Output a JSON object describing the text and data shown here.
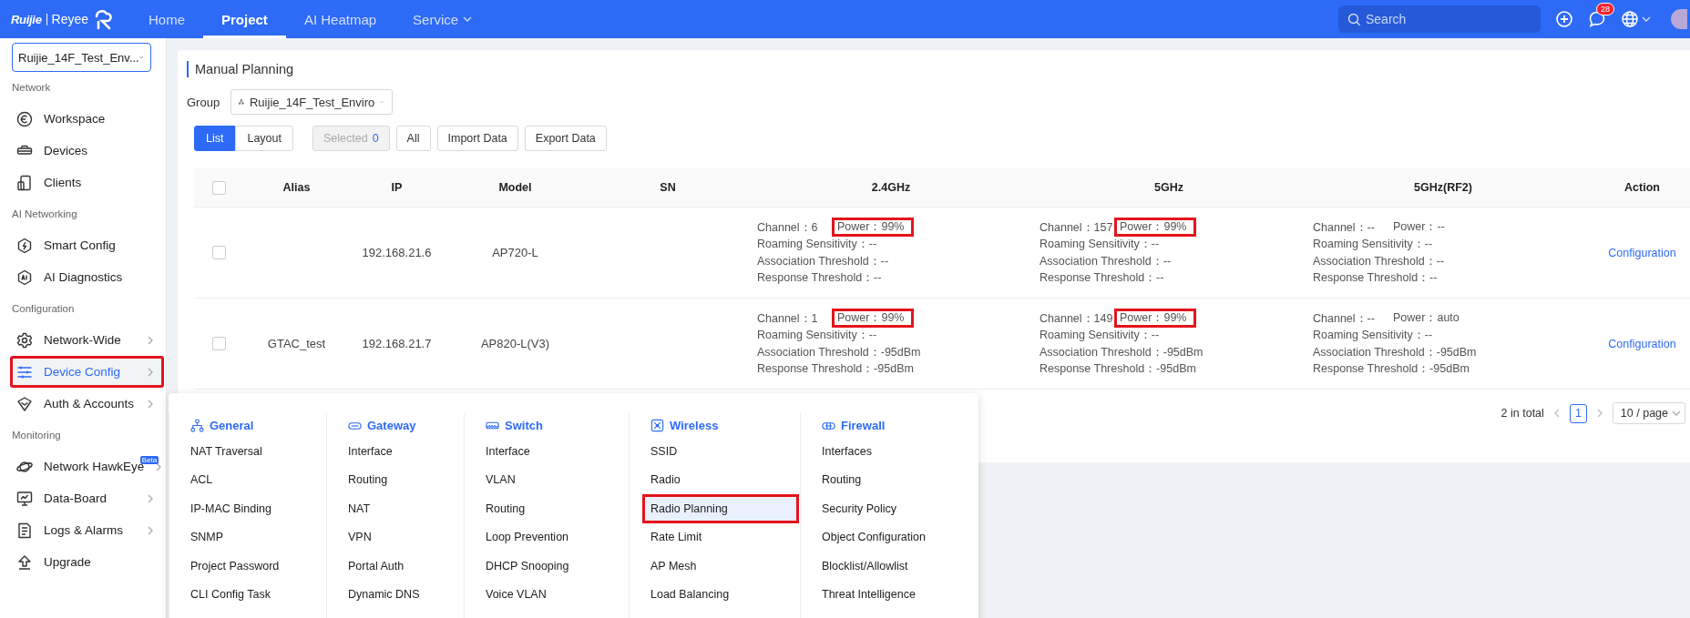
{
  "topbar": {
    "logo": {
      "brand": "Ruijie",
      "product": "Reyee"
    },
    "nav": [
      {
        "label": "Home",
        "selected": false,
        "has_dropdown": false
      },
      {
        "label": "Project",
        "selected": true,
        "has_dropdown": false
      },
      {
        "label": "AI Heatmap",
        "selected": false,
        "has_dropdown": false
      },
      {
        "label": "Service",
        "selected": false,
        "has_dropdown": true
      }
    ],
    "search": {
      "placeholder": "Search"
    },
    "notifications": {
      "badge": "28"
    }
  },
  "sidebar": {
    "project_select": {
      "value": "Ruijie_14F_Test_Env..."
    },
    "sections": [
      {
        "title": "Network",
        "items": [
          {
            "label": "Workspace",
            "selected": false,
            "highlighted": false,
            "has_submenu": false
          },
          {
            "label": "Devices",
            "selected": false,
            "highlighted": false,
            "has_submenu": false
          },
          {
            "label": "Clients",
            "selected": false,
            "highlighted": false,
            "has_submenu": false
          }
        ]
      },
      {
        "title": "AI Networking",
        "items": [
          {
            "label": "Smart Config",
            "selected": false,
            "highlighted": false,
            "has_submenu": false
          },
          {
            "label": "AI Diagnostics",
            "selected": false,
            "highlighted": false,
            "has_submenu": false
          }
        ]
      },
      {
        "title": "Configuration",
        "items": [
          {
            "label": "Network-Wide",
            "selected": false,
            "highlighted": false,
            "has_submenu": true
          },
          {
            "label": "Device Config",
            "selected": true,
            "highlighted": true,
            "has_submenu": true
          },
          {
            "label": "Auth & Accounts",
            "selected": false,
            "highlighted": false,
            "has_submenu": true
          }
        ]
      },
      {
        "title": "Monitoring",
        "items": [
          {
            "label": "Network HawkEye",
            "badge": "Beta",
            "selected": false,
            "highlighted": false,
            "has_submenu": true
          },
          {
            "label": "Data-Board",
            "selected": false,
            "highlighted": false,
            "has_submenu": true
          },
          {
            "label": "Logs & Alarms",
            "selected": false,
            "highlighted": false,
            "has_submenu": true
          },
          {
            "label": "Upgrade",
            "selected": false,
            "highlighted": false,
            "has_submenu": false
          }
        ]
      }
    ]
  },
  "planning": {
    "title": "Manual Planning",
    "group": {
      "label": "Group",
      "value": "Ruijie_14F_Test_Enviro"
    },
    "view_toggle": [
      {
        "label": "List",
        "selected": true
      },
      {
        "label": "Layout",
        "selected": false
      }
    ],
    "selected_button": {
      "label": "Selected",
      "count": "0",
      "disabled": true
    },
    "buttons": [
      "All",
      "Import Data",
      "Export Data"
    ],
    "table": {
      "header_checkbox": {
        "checked": false
      },
      "columns": [
        "Alias",
        "IP",
        "Model",
        "SN",
        "2.4GHz",
        "5GHz",
        "5GHz(RF2)",
        "Action"
      ],
      "rows": [
        {
          "checked": false,
          "alias": "",
          "ip": "192.168.21.6",
          "model": "AP720-L",
          "action": "Configuration",
          "radios": [
            {
              "channel": "Channel：6",
              "power": "Power：99%",
              "highlighted": true,
              "details": [
                "Roaming Sensitivity：--",
                "Association Threshold：--",
                "Response Threshold：--"
              ]
            },
            {
              "channel": "Channel：157",
              "power": "Power：99%",
              "highlighted": true,
              "details": [
                "Roaming Sensitivity：--",
                "Association Threshold：--",
                "Response Threshold：--"
              ]
            },
            {
              "channel": "Channel：--",
              "power": "Power：--",
              "highlighted": false,
              "details": [
                "Roaming Sensitivity：--",
                "Association Threshold：--",
                "Response Threshold：--"
              ]
            }
          ]
        },
        {
          "checked": false,
          "alias": "GTAC_test",
          "ip": "192.168.21.7",
          "model": "AP820-L(V3)",
          "action": "Configuration",
          "radios": [
            {
              "channel": "Channel：1",
              "power": "Power：99%",
              "highlighted": true,
              "details": [
                "Roaming Sensitivity：--",
                "Association Threshold：-95dBm",
                "Response Threshold：-95dBm"
              ]
            },
            {
              "channel": "Channel：149",
              "power": "Power：99%",
              "highlighted": true,
              "details": [
                "Roaming Sensitivity：--",
                "Association Threshold：-95dBm",
                "Response Threshold：-95dBm"
              ]
            },
            {
              "channel": "Channel：--",
              "power": "Power：auto",
              "highlighted": false,
              "details": [
                "Roaming Sensitivity：--",
                "Association Threshold：-95dBm",
                "Response Threshold：-95dBm"
              ]
            }
          ]
        }
      ]
    },
    "pagination": {
      "total": "2 in total",
      "pages": [
        {
          "label": "1",
          "selected": true
        }
      ],
      "page_size": "10 / page"
    }
  },
  "config_menu": {
    "columns": [
      {
        "title": "General",
        "items": [
          {
            "label": "NAT Traversal",
            "selected": false,
            "highlighted": false
          },
          {
            "label": "ACL",
            "selected": false,
            "highlighted": false
          },
          {
            "label": "IP-MAC Binding",
            "selected": false,
            "highlighted": false
          },
          {
            "label": "SNMP",
            "selected": false,
            "highlighted": false
          },
          {
            "label": "Project Password",
            "selected": false,
            "highlighted": false
          },
          {
            "label": "CLI Config Task",
            "selected": false,
            "highlighted": false
          }
        ]
      },
      {
        "title": "Gateway",
        "items": [
          {
            "label": "Interface",
            "selected": false,
            "highlighted": false
          },
          {
            "label": "Routing",
            "selected": false,
            "highlighted": false
          },
          {
            "label": "NAT",
            "selected": false,
            "highlighted": false
          },
          {
            "label": "VPN",
            "selected": false,
            "highlighted": false
          },
          {
            "label": "Portal Auth",
            "selected": false,
            "highlighted": false
          },
          {
            "label": "Dynamic DNS",
            "selected": false,
            "highlighted": false
          }
        ]
      },
      {
        "title": "Switch",
        "items": [
          {
            "label": "Interface",
            "selected": false,
            "highlighted": false
          },
          {
            "label": "VLAN",
            "selected": false,
            "highlighted": false
          },
          {
            "label": "Routing",
            "selected": false,
            "highlighted": false
          },
          {
            "label": "Loop Prevention",
            "selected": false,
            "highlighted": false
          },
          {
            "label": "DHCP Snooping",
            "selected": false,
            "highlighted": false
          },
          {
            "label": "Voice VLAN",
            "selected": false,
            "highlighted": false
          }
        ]
      },
      {
        "title": "Wireless",
        "items": [
          {
            "label": "SSID",
            "selected": false,
            "highlighted": false
          },
          {
            "label": "Radio",
            "selected": false,
            "highlighted": false
          },
          {
            "label": "Radio Planning",
            "selected": true,
            "highlighted": true
          },
          {
            "label": "Rate Limit",
            "selected": false,
            "highlighted": false
          },
          {
            "label": "AP Mesh",
            "selected": false,
            "highlighted": false
          },
          {
            "label": "Load Balancing",
            "selected": false,
            "highlighted": false
          }
        ]
      },
      {
        "title": "Firewall",
        "items": [
          {
            "label": "Interfaces",
            "selected": false,
            "highlighted": false
          },
          {
            "label": "Routing",
            "selected": false,
            "highlighted": false
          },
          {
            "label": "Security Policy",
            "selected": false,
            "highlighted": false
          },
          {
            "label": "Object Configuration",
            "selected": false,
            "highlighted": false
          },
          {
            "label": "Blocklist/Allowlist",
            "selected": false,
            "highlighted": false
          },
          {
            "label": "Threat Intelligence",
            "selected": false,
            "highlighted": false
          }
        ]
      }
    ]
  }
}
